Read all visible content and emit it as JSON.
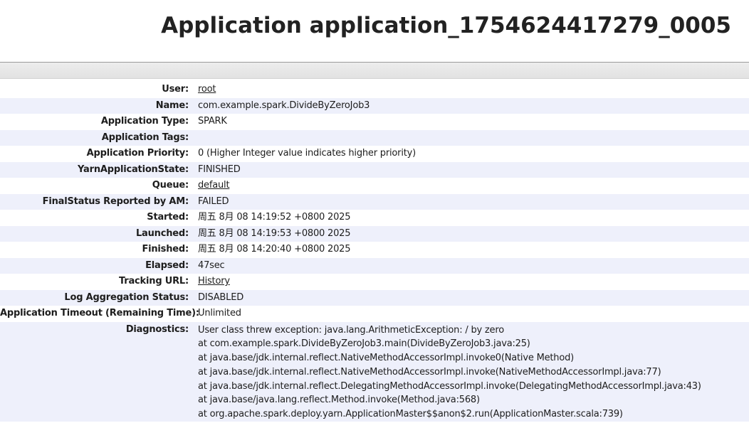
{
  "page": {
    "title": "Application application_1754624417279_0005"
  },
  "overview": {
    "rows": [
      {
        "label": "User:",
        "value": "root",
        "link": true
      },
      {
        "label": "Name:",
        "value": "com.example.spark.DivideByZeroJob3",
        "link": false
      },
      {
        "label": "Application Type:",
        "value": "SPARK",
        "link": false
      },
      {
        "label": "Application Tags:",
        "value": "",
        "link": false
      },
      {
        "label": "Application Priority:",
        "value": "0 (Higher Integer value indicates higher priority)",
        "link": false
      },
      {
        "label": "YarnApplicationState:",
        "value": "FINISHED",
        "link": false
      },
      {
        "label": "Queue:",
        "value": "default",
        "link": true
      },
      {
        "label": "FinalStatus Reported by AM:",
        "value": "FAILED",
        "link": false
      },
      {
        "label": "Started:",
        "value": "周五 8月 08 14:19:52 +0800 2025",
        "link": false
      },
      {
        "label": "Launched:",
        "value": "周五 8月 08 14:19:53 +0800 2025",
        "link": false
      },
      {
        "label": "Finished:",
        "value": "周五 8月 08 14:20:40 +0800 2025",
        "link": false
      },
      {
        "label": "Elapsed:",
        "value": "47sec",
        "link": false
      },
      {
        "label": "Tracking URL:",
        "value": "History",
        "link": true
      },
      {
        "label": "Log Aggregation Status:",
        "value": "DISABLED",
        "link": false
      },
      {
        "label": "Application Timeout (Remaining Time):",
        "value": "Unlimited",
        "link": false
      }
    ],
    "diagnostics": {
      "label": "Diagnostics:",
      "lines": [
        "User class threw exception: java.lang.ArithmeticException: / by zero",
        "at com.example.spark.DivideByZeroJob3.main(DivideByZeroJob3.java:25)",
        "at java.base/jdk.internal.reflect.NativeMethodAccessorImpl.invoke0(Native Method)",
        "at java.base/jdk.internal.reflect.NativeMethodAccessorImpl.invoke(NativeMethodAccessorImpl.java:77)",
        "at java.base/jdk.internal.reflect.DelegatingMethodAccessorImpl.invoke(DelegatingMethodAccessorImpl.java:43)",
        "at java.base/java.lang.reflect.Method.invoke(Method.java:568)",
        "at org.apache.spark.deploy.yarn.ApplicationMaster$$anon$2.run(ApplicationMaster.scala:739)"
      ]
    }
  }
}
